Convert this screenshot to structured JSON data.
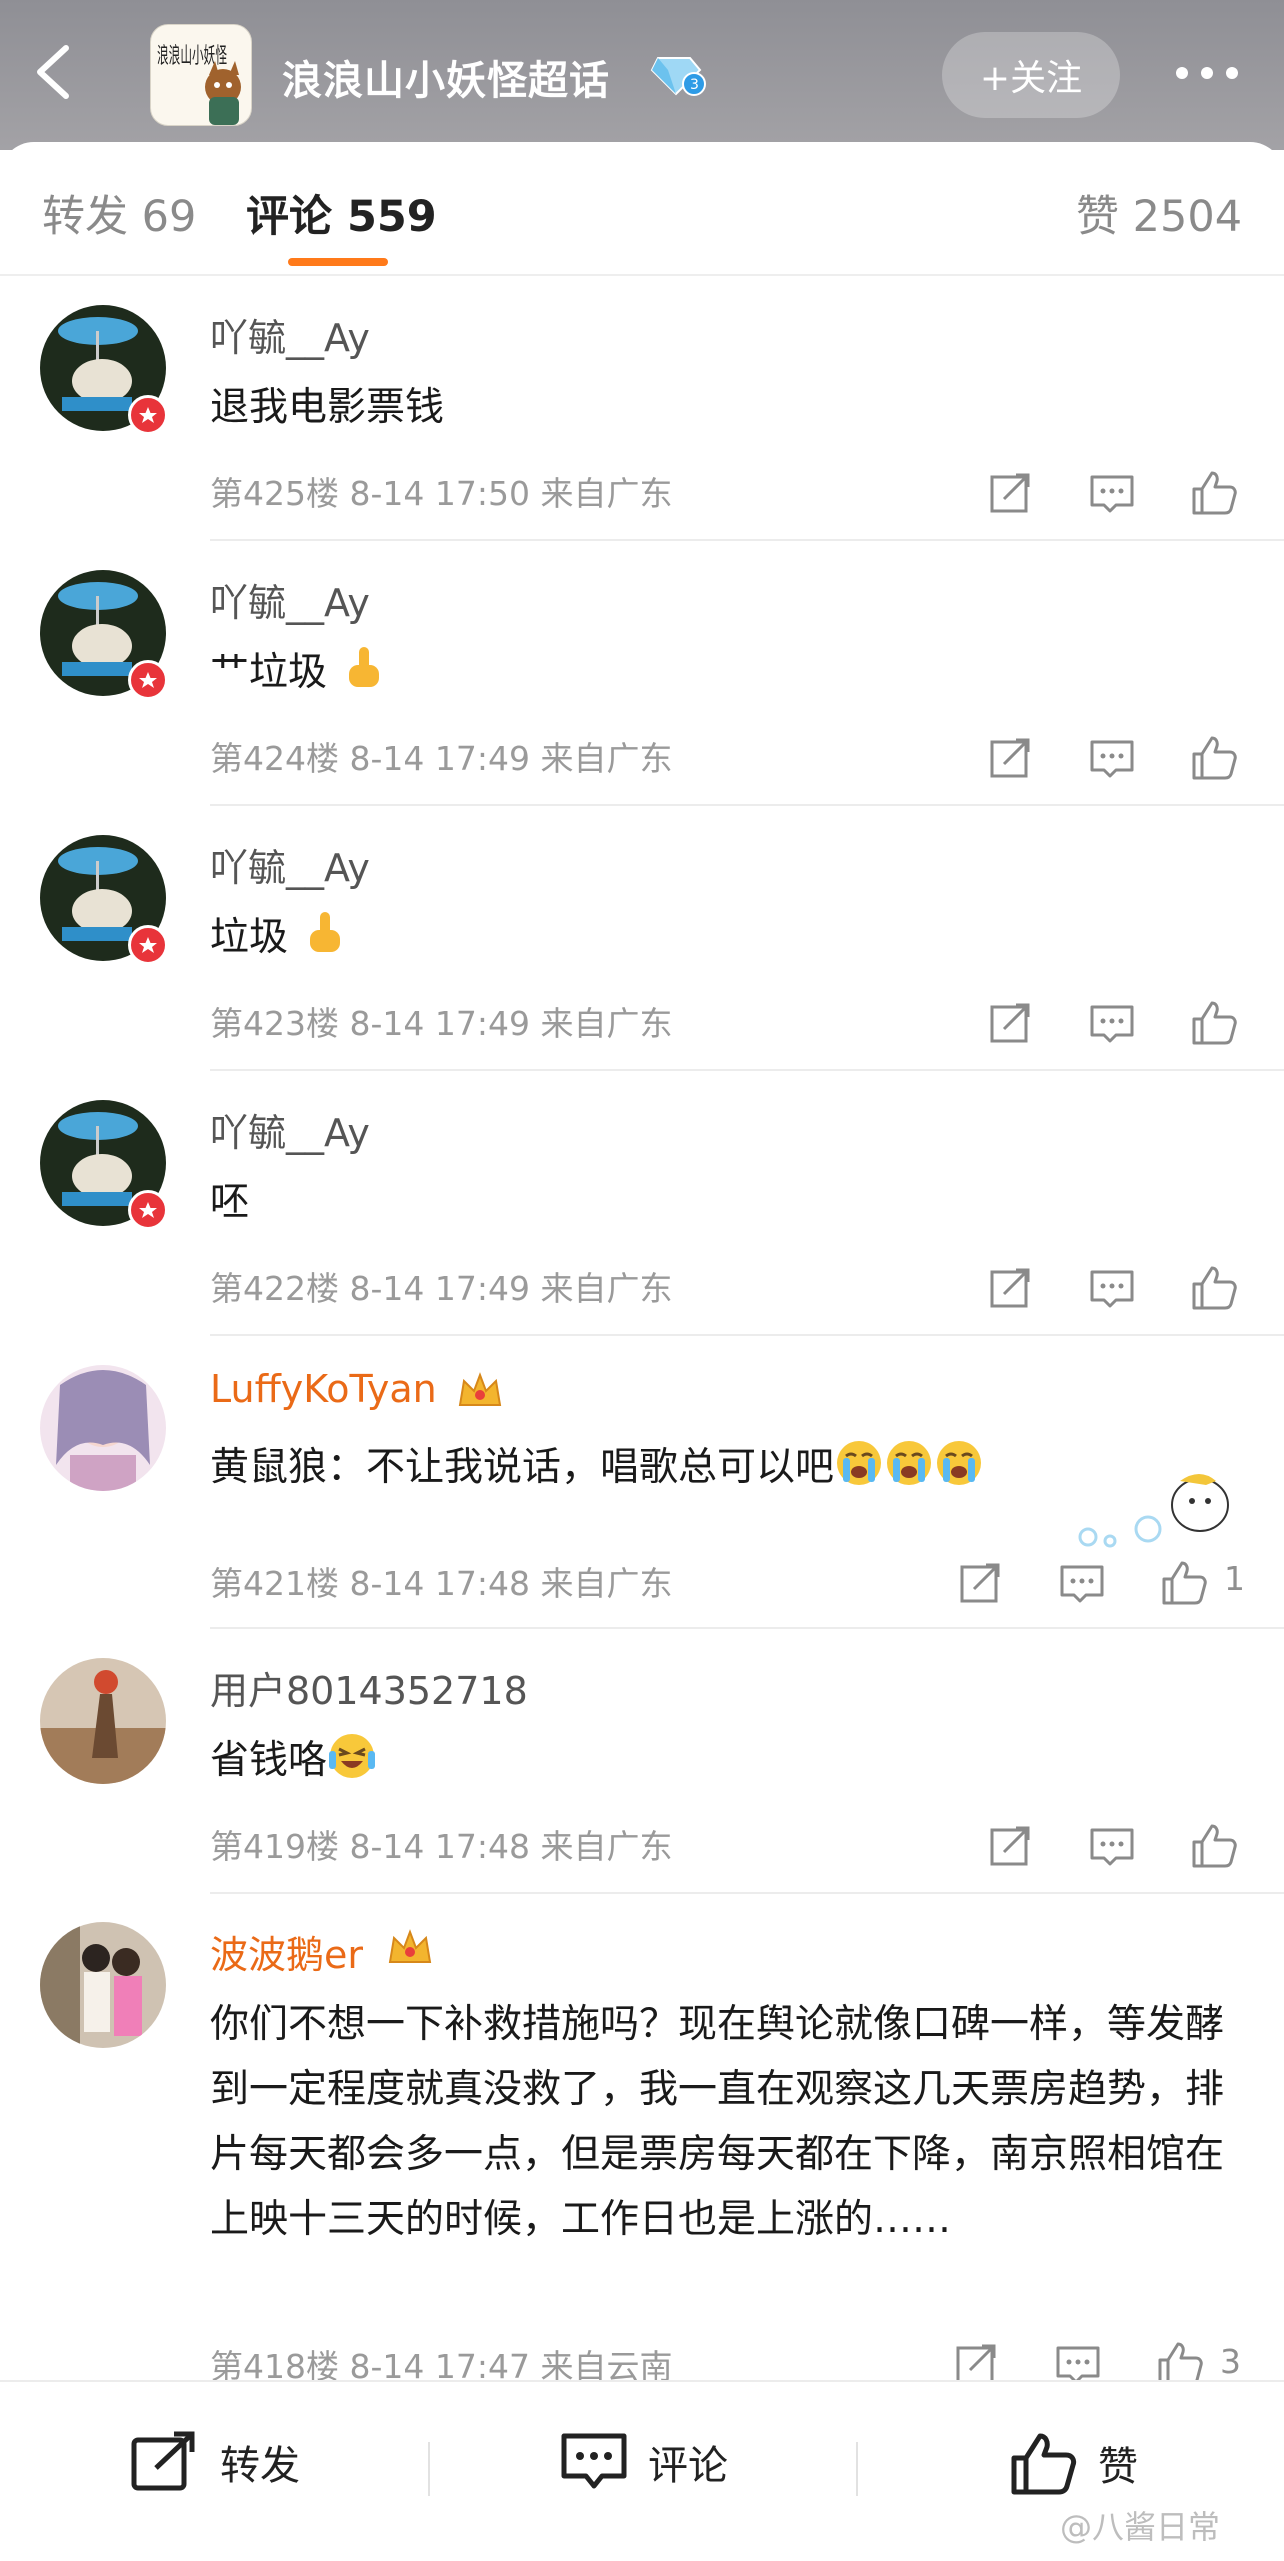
{
  "header": {
    "title": "浪浪山小妖怪超话",
    "follow_label": "+关注",
    "avatar_text": "浪浪山小妖怪"
  },
  "tabs": {
    "repost": "转发 69",
    "comment": "评论 559",
    "like": "赞 2504"
  },
  "comments": [
    {
      "user": "吖毓__Ay",
      "text": "退我电影票钱",
      "meta": "第425楼 8-14 17:50 来自广东",
      "likes": ""
    },
    {
      "user": "吖毓__Ay",
      "text": "艹垃圾",
      "meta": "第424楼 8-14 17:49 来自广东",
      "likes": ""
    },
    {
      "user": "吖毓__Ay",
      "text": "垃圾",
      "meta": "第423楼 8-14 17:49 来自广东",
      "likes": ""
    },
    {
      "user": "吖毓__Ay",
      "text": "呸",
      "meta": "第422楼 8-14 17:49 来自广东",
      "likes": ""
    },
    {
      "user": "LuffyKoTyan",
      "text": "黄鼠狼：不让我说话，唱歌总可以吧",
      "meta": "第421楼 8-14 17:48 来自广东",
      "likes": "1"
    },
    {
      "user": "用户8014352718",
      "text": "省钱咯",
      "meta": "第419楼 8-14 17:48 来自广东",
      "likes": ""
    },
    {
      "user": "波波鹅er",
      "text": "你们不想一下补救措施吗？现在舆论就像口碑一样，等发酵到一定程度就真没救了，我一直在观察这几天票房趋势，排片每天都会多一点，但是票房每天都在下降，南京照相馆在上映十三天的时候，工作日也是上涨的……",
      "meta": "第418楼 8-14 17:47 来自云南",
      "likes": "3"
    }
  ],
  "bottom": {
    "repost": "转发",
    "comment": "评论",
    "like": "赞"
  },
  "watermark": "@八酱日常",
  "colors": {
    "accent": "#ff7a1a",
    "vip_name": "#ea6a17",
    "header_bg": "#9a999e"
  }
}
